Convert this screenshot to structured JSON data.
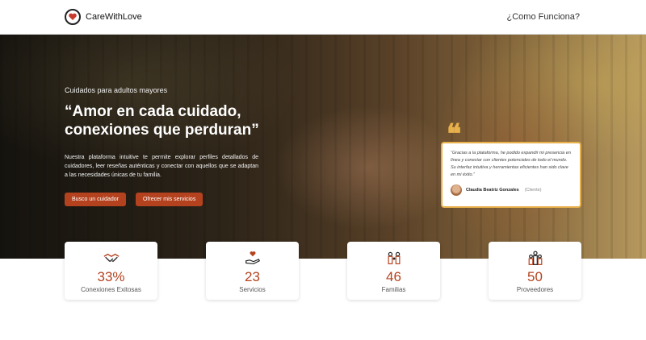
{
  "header": {
    "brand_name": "CareWithLove",
    "nav_link": "¿Como Funciona?"
  },
  "hero": {
    "eyebrow": "Cuidados para adultos mayores",
    "headline": "“Amor en cada cuidado, conexiones que perduran”",
    "description": "Nuestra plataforma intuitive te permite explorar perfiles detallados de cuidadores, leer reseñas auténticas y conectar con aquellos que se adaptan a las necesidades únicas de tu familia.",
    "buttons": [
      {
        "label": "Busco un cuidador"
      },
      {
        "label": "Ofrecer mis servicios"
      }
    ]
  },
  "testimonial": {
    "text": "“Gracias a la plataforma, he podido expandir mi presencia en línea y conectar con clientes potenciales de todo el mundo. Su interfaz intuitiva y herramientas eficientes han sido clave en mi éxito.”",
    "author": "Claudia Beatriz Gonzales",
    "role": "(Cliente)"
  },
  "stats": [
    {
      "value": "33%",
      "label": "Conexiones Exitosas",
      "icon": "handshake-icon"
    },
    {
      "value": "23",
      "label": "Servicios",
      "icon": "hand-heart-icon"
    },
    {
      "value": "46",
      "label": "Familias",
      "icon": "family-icon"
    },
    {
      "value": "50",
      "label": "Proveedores",
      "icon": "caregivers-icon"
    }
  ],
  "colors": {
    "accent": "#b5421e",
    "quote": "#e8b04b"
  }
}
